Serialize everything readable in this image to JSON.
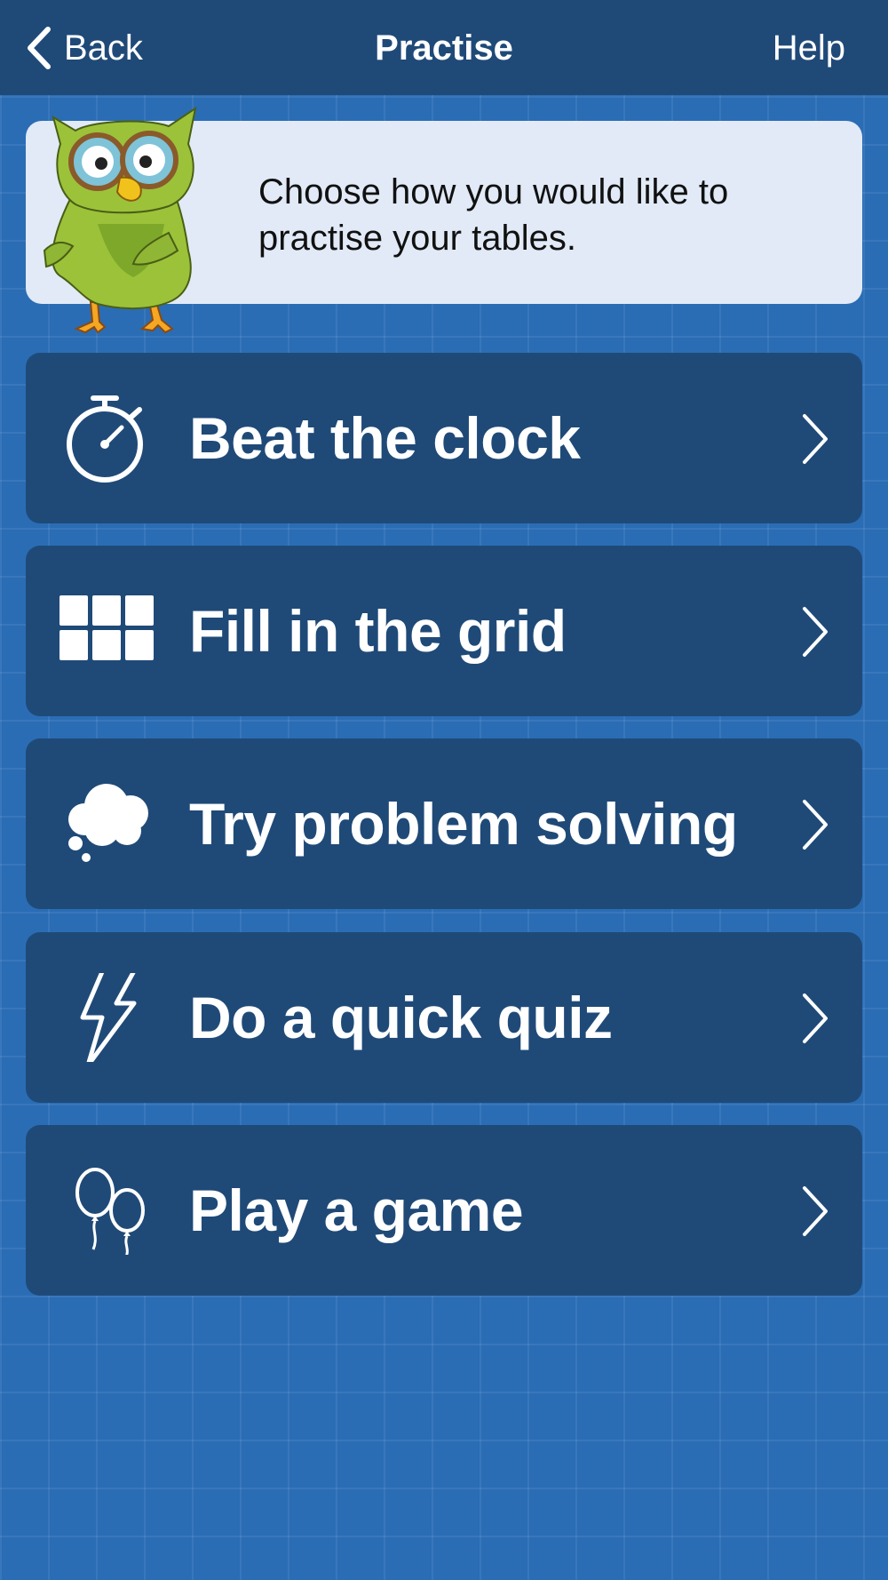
{
  "nav": {
    "back_label": "Back",
    "title": "Practise",
    "help_label": "Help"
  },
  "intro": {
    "text": "Choose how you would like to practise your tables."
  },
  "menu": {
    "items": [
      {
        "label": "Beat the clock",
        "icon": "stopwatch-icon"
      },
      {
        "label": "Fill in the grid",
        "icon": "grid-icon"
      },
      {
        "label": "Try problem solving",
        "icon": "thought-cloud-icon"
      },
      {
        "label": "Do a quick quiz",
        "icon": "lightning-bolt-icon"
      },
      {
        "label": "Play a game",
        "icon": "balloons-icon"
      }
    ]
  },
  "colors": {
    "background": "#2a6db5",
    "navbar": "#1f4a78",
    "menu_item": "#1f4a78",
    "info_card": "#e1eaf6",
    "text_light": "#ffffff"
  }
}
